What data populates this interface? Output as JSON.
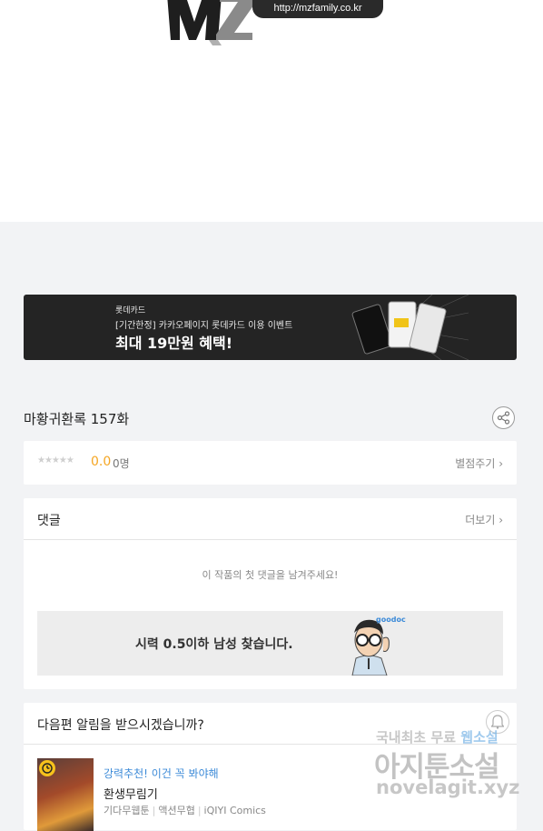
{
  "logo": {
    "url_text": "http://mzfamily.co.kr"
  },
  "banner": {
    "brand": "롯데카드",
    "subtitle": "[기간한정] 카카오페이지 롯데카드 이용 이벤트",
    "headline": "최대 19만원 혜택!"
  },
  "episode": {
    "title": "마황귀환록 157화"
  },
  "rating": {
    "stars": "★★★★★",
    "score": "0.0",
    "count": "0명",
    "rate_link": "별점주기 ›"
  },
  "comments": {
    "title": "댓글",
    "more_link": "더보기 ›",
    "empty_message": "이 작품의 첫 댓글을 남겨주세요!",
    "ad": {
      "text": "시력 0.5이하 남성 찾습니다.",
      "brand": "goodoc"
    }
  },
  "next_notice": {
    "title": "다음편 알림을 받으시겠습니까?",
    "recommend_label": "강력추천! 이건 꼭 봐야해",
    "series_title": "환생무림기",
    "tags": [
      "기다무웹툰",
      "액션무협",
      "iQIYI Comics"
    ]
  },
  "watermark": {
    "line1_a": "국내최초 무료",
    "line1_b": "웹소설",
    "line2": "아지툰소설",
    "line3": "novelagit.xyz"
  }
}
